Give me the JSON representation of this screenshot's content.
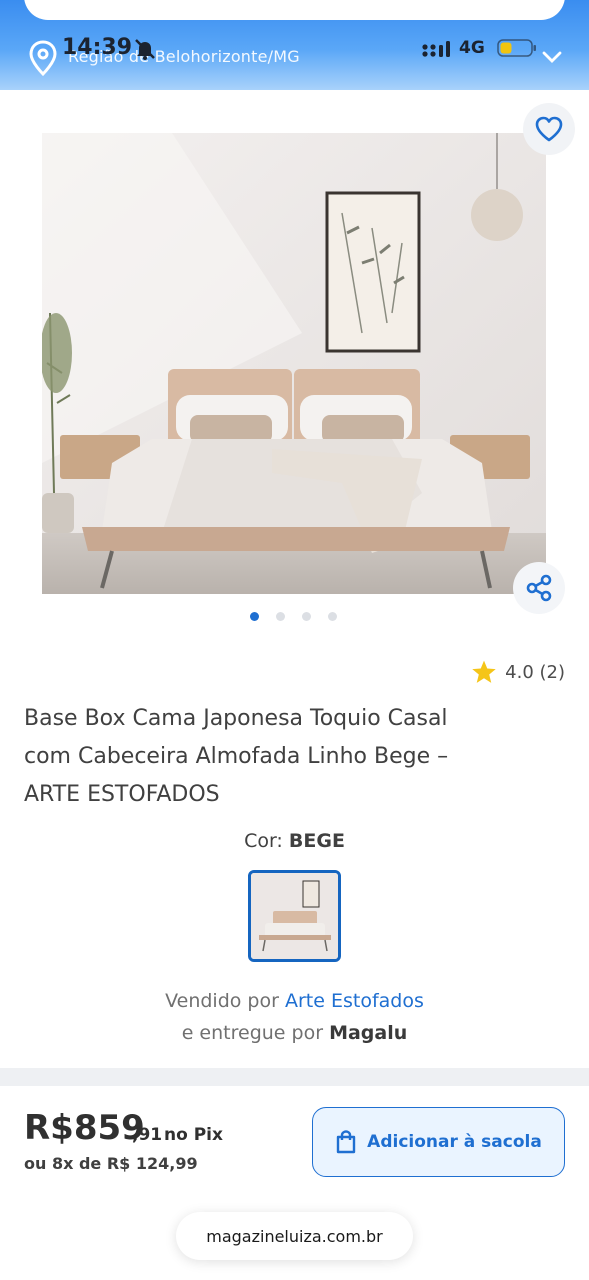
{
  "status_bar": {
    "time": "14:39",
    "network": "4G"
  },
  "header": {
    "location": "Região de Belohorizonte/MG",
    "brand_color": "#3a8df0"
  },
  "gallery": {
    "image_count": 4,
    "active_index": 0,
    "image_alt": "bed-photo"
  },
  "product": {
    "rating": "4.0 (2)",
    "title_lines": [
      "Base Box Cama Japonesa Toquio Casal",
      "com Cabeceira Almofada Linho Bege –",
      "ARTE ESTOFADOS"
    ],
    "color_label": "Cor:",
    "color_value": "BEGE",
    "sold_by_prefix": "Vendido por",
    "seller": "Arte Estofados",
    "delivered_prefix": "e entregue por",
    "delivered_by": "Magalu"
  },
  "price": {
    "main": "R$859",
    "cents": ",91",
    "method": "no Pix",
    "installments": "ou 8x de R$ 124,99"
  },
  "actions": {
    "add_to_bag": "Adicionar à sacola"
  },
  "browser": {
    "url": "magazineluiza.com.br"
  }
}
